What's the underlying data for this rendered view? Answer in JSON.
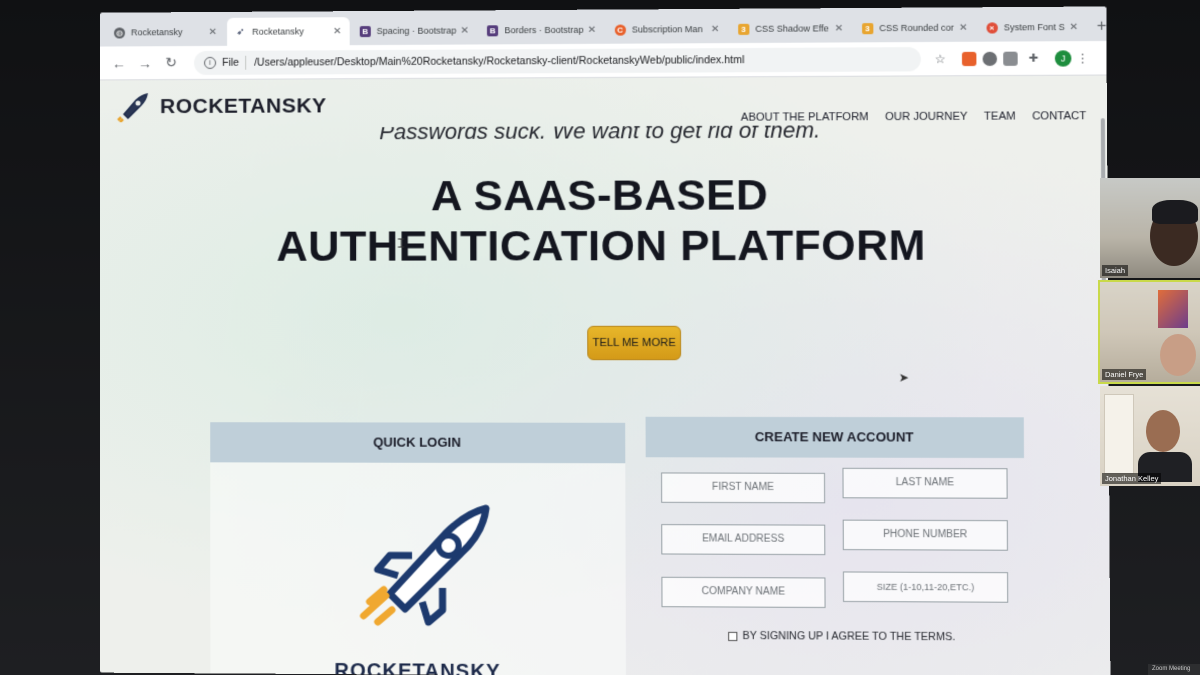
{
  "browser": {
    "tabs": [
      {
        "title": "Rocketansky",
        "favicon": "globe-icon",
        "color": "#5f6368",
        "active": false
      },
      {
        "title": "Rocketansky",
        "favicon": "rocket-icon",
        "color": "#1d2a4a",
        "active": true
      },
      {
        "title": "Spacing · Bootstrap",
        "favicon": "bootstrap-icon",
        "color": "#563d7c",
        "active": false
      },
      {
        "title": "Borders · Bootstrap",
        "favicon": "bootstrap-icon",
        "color": "#563d7c",
        "active": false
      },
      {
        "title": "Subscription Man",
        "favicon": "c-icon",
        "color": "#e8612c",
        "active": false
      },
      {
        "title": "CSS Shadow Effe",
        "favicon": "css-icon",
        "color": "#e8a530",
        "active": false
      },
      {
        "title": "CSS Rounded cor",
        "favicon": "css-icon",
        "color": "#e8a530",
        "active": false
      },
      {
        "title": "System Font Stac",
        "favicon": "x-icon",
        "color": "#e04f3a",
        "active": false
      }
    ],
    "address": {
      "scheme": "File",
      "url": "/Users/appleuser/Desktop/Main%20Rocketansky/Rocketansky-client/RocketanskyWeb/public/index.html"
    },
    "profile_initial": "J"
  },
  "site": {
    "brand": "ROCKETANSKY",
    "nav": [
      "ABOUT THE PLATFORM",
      "OUR JOURNEY",
      "TEAM",
      "CONTACT"
    ],
    "tagline": "Passwords suck. We want to get rid of them.",
    "headline_line1": "A SAAS-BASED",
    "headline_line2": "AUTHENTICATION PLATFORM",
    "cta": "TELL ME MORE",
    "quick_login": {
      "title": "QUICK LOGIN",
      "brand": "ROCKETANSKY"
    },
    "create_account": {
      "title": "CREATE NEW ACCOUNT",
      "fields": [
        {
          "placeholder": "FIRST NAME"
        },
        {
          "placeholder": "LAST NAME"
        },
        {
          "placeholder": "EMAIL ADDRESS"
        },
        {
          "placeholder": "PHONE NUMBER"
        },
        {
          "placeholder": "COMPANY NAME"
        },
        {
          "placeholder": "SIZE (1-10,11-20,ETC.)"
        }
      ],
      "terms": "BY SIGNING UP I AGREE TO THE TERMS."
    }
  },
  "zoom": {
    "participants": [
      {
        "name": "Isaiah",
        "speaking": false
      },
      {
        "name": "Daniel Frye",
        "speaking": true
      },
      {
        "name": "Jonathan Kelley",
        "speaking": false
      }
    ],
    "bar_label": "Zoom Meeting"
  }
}
